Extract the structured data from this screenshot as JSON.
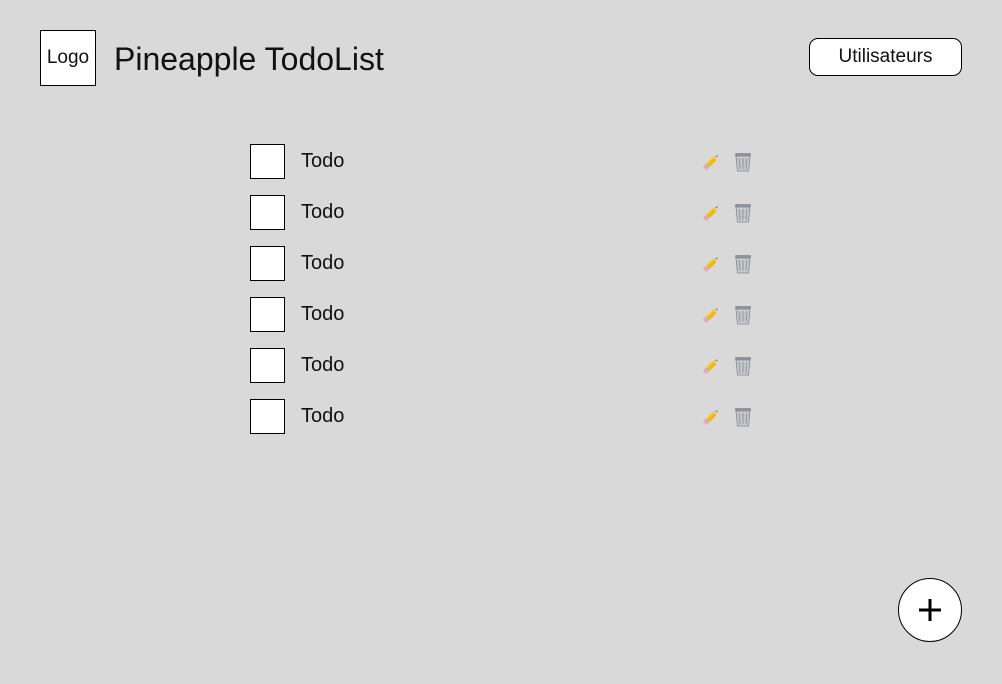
{
  "header": {
    "logo_text": "Logo",
    "title": "Pineapple TodoList",
    "users_button_label": "Utilisateurs"
  },
  "todos": [
    {
      "label": "Todo",
      "checked": false,
      "edit_icon": "pencil-icon",
      "delete_icon": "trash-icon"
    },
    {
      "label": "Todo",
      "checked": false,
      "edit_icon": "pencil-icon",
      "delete_icon": "trash-icon"
    },
    {
      "label": "Todo",
      "checked": false,
      "edit_icon": "pencil-icon",
      "delete_icon": "trash-icon"
    },
    {
      "label": "Todo",
      "checked": false,
      "edit_icon": "pencil-icon",
      "delete_icon": "trash-icon"
    },
    {
      "label": "Todo",
      "checked": false,
      "edit_icon": "pencil-icon",
      "delete_icon": "trash-icon"
    },
    {
      "label": "Todo",
      "checked": false,
      "edit_icon": "pencil-icon",
      "delete_icon": "trash-icon"
    }
  ],
  "fab": {
    "icon": "plus-icon"
  },
  "colors": {
    "background": "#d9d9d9",
    "surface": "#ffffff",
    "border": "#000000"
  }
}
